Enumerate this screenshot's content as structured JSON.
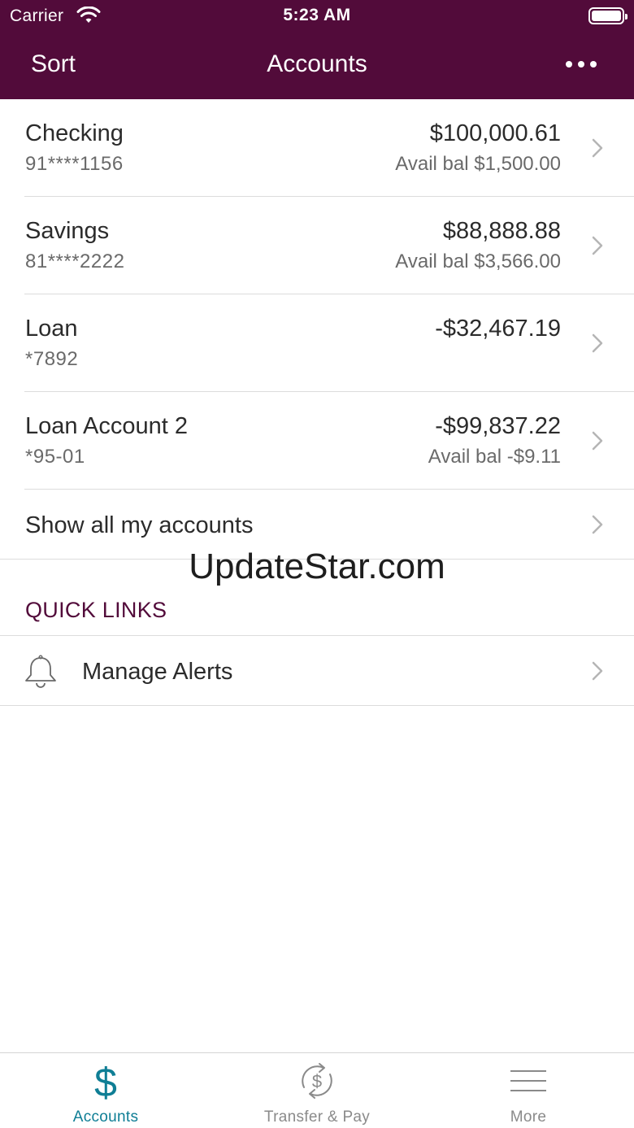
{
  "status_bar": {
    "carrier": "Carrier",
    "time": "5:23 AM"
  },
  "nav": {
    "left_label": "Sort",
    "title": "Accounts",
    "menu_icon": "more-dots-icon"
  },
  "accounts": [
    {
      "name": "Checking",
      "number": "91****1156",
      "balance": "$100,000.61",
      "available": "Avail bal $1,500.00"
    },
    {
      "name": "Savings",
      "number": "81****2222",
      "balance": "$88,888.88",
      "available": "Avail bal $3,566.00"
    },
    {
      "name": "Loan",
      "number": "*7892",
      "balance": "-$32,467.19",
      "available": ""
    },
    {
      "name": "Loan Account 2",
      "number": "*95-01",
      "balance": "-$99,837.22",
      "available": "Avail bal -$9.11"
    }
  ],
  "show_all": "Show all my accounts",
  "watermark": "UpdateStar.com",
  "quick_links": {
    "title": "QUICK LINKS",
    "items": [
      {
        "label": "Manage Alerts",
        "icon": "bell-icon"
      }
    ]
  },
  "tabbar": {
    "tabs": [
      {
        "label": "Accounts",
        "icon": "dollar-icon",
        "active": true
      },
      {
        "label": "Transfer & Pay",
        "icon": "transfer-dollar-icon",
        "active": false
      },
      {
        "label": "More",
        "icon": "hamburger-menu-icon",
        "active": false
      }
    ]
  },
  "colors": {
    "brand": "#520b3a",
    "accent": "#0f7e95",
    "muted": "#8a8a8a"
  }
}
